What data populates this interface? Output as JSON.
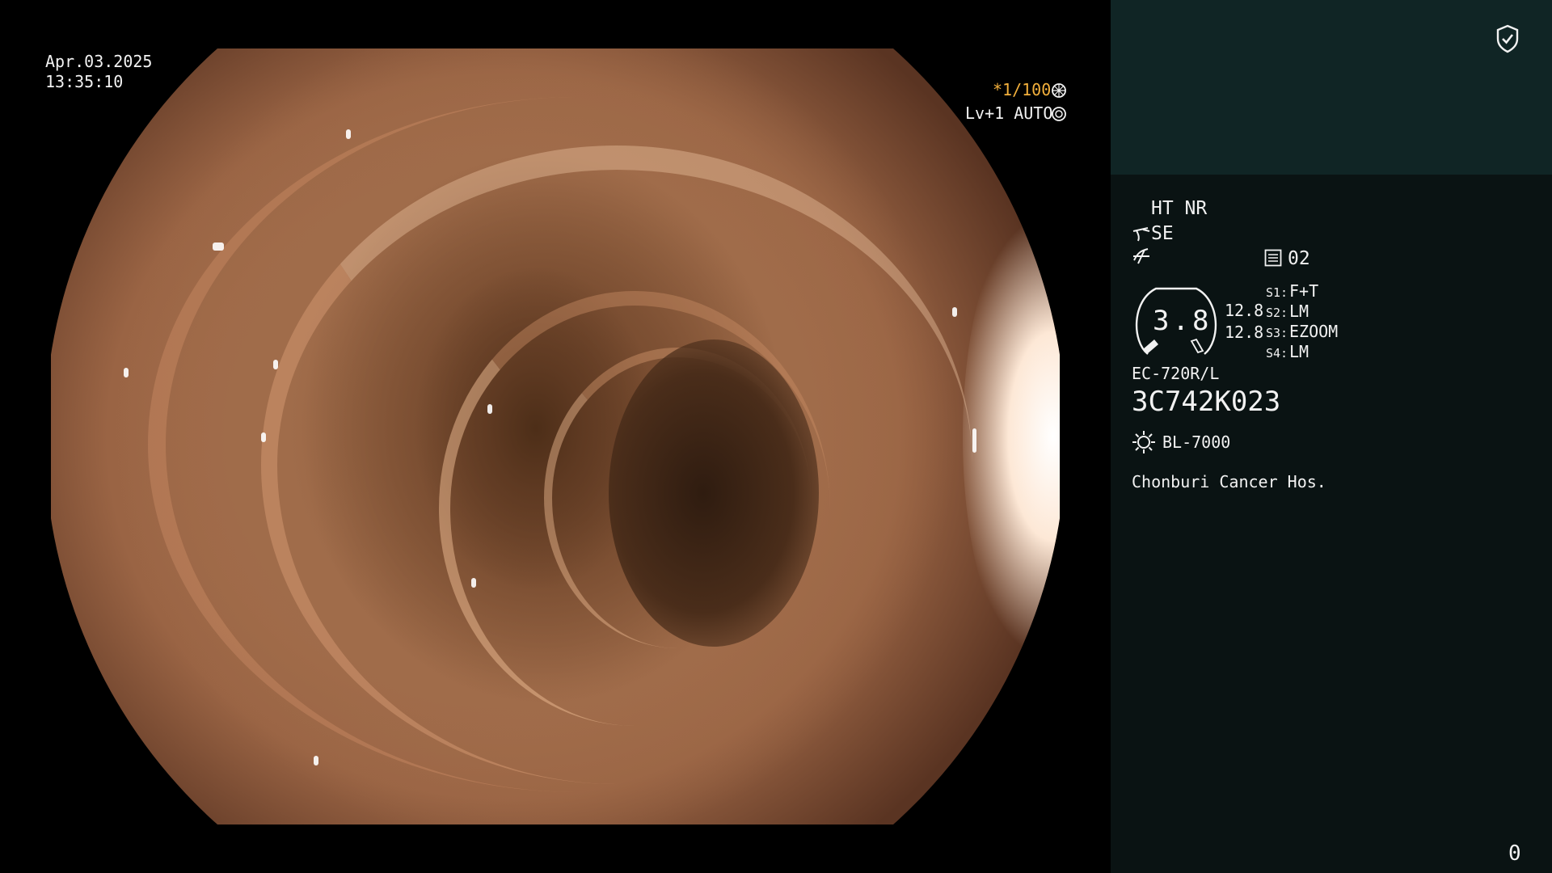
{
  "datetime": {
    "date": "Apr.03.2025",
    "time": "13:35:10"
  },
  "shutter": {
    "value": "*1/100",
    "icon": "shutter-icon"
  },
  "iris": {
    "value": "Lv+1 AUTO",
    "icon": "iris-icon"
  },
  "panel": {
    "ht_nr": "HT NR",
    "se_label": "SE",
    "se_color": "#f3b03c",
    "memory_icon": "memory-icon",
    "memory_value": "02",
    "zoom_value": "3.8",
    "scale_top": "12.8",
    "scale_bottom": "12.8",
    "switches": [
      {
        "key": "S1:",
        "value": "F+T"
      },
      {
        "key": "S2:",
        "value": "LM"
      },
      {
        "key": "S3:",
        "value": "EZOOM"
      },
      {
        "key": "S4:",
        "value": "LM"
      }
    ],
    "scope_model": "EC-720R/L",
    "serial": "3C742K023",
    "light_source": "BL-7000",
    "hospital": "Chonburi Cancer Hos.",
    "counter": "0"
  },
  "colors": {
    "panel_bg": "#0a1313",
    "panel_top_bg": "#102525",
    "accent": "#f3b03c"
  }
}
